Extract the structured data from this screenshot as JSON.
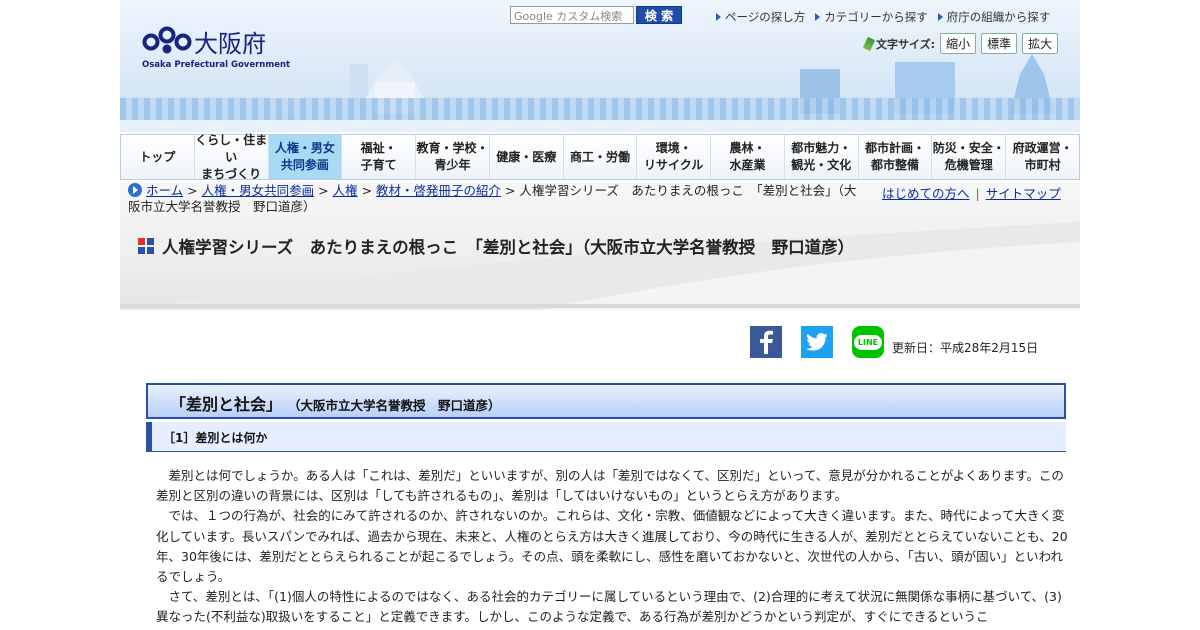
{
  "header": {
    "logo_name": "大阪府",
    "logo_english": "Osaka Prefectural Government",
    "search_placeholder": "Google カスタム検索",
    "search_button": "検 索",
    "top_links": [
      "ページの探し方",
      "カテゴリーから探す",
      "府庁の組織から探す"
    ],
    "font_size_label": "文字サイズ:",
    "font_size_buttons": [
      "縮小",
      "標準",
      "拡大"
    ]
  },
  "nav": {
    "items": [
      "トップ",
      "くらし・住まい\nまちづくり",
      "人権・男女\n共同参画",
      "福祉・\n子育て",
      "教育・学校・\n青少年",
      "健康・医療",
      "商工・労働",
      "環境・\nリサイクル",
      "農林・\n水産業",
      "都市魅力・\n観光・文化",
      "都市計画・\n都市整備",
      "防災・安全・\n危機管理",
      "府政運営・\n市町村"
    ],
    "active_index": 2
  },
  "breadcrumb": {
    "links": [
      "ホーム",
      "人権・男女共同参画",
      "人権",
      "教材・啓発冊子の紹介"
    ],
    "current": "人権学習シリーズ　あたりまえの根っこ　「差別と社会」（大阪市立大学名誉教授　野口道彦）",
    "separator": ">"
  },
  "utility_links": [
    "はじめての方へ",
    "サイトマップ"
  ],
  "page_title": "人権学習シリーズ　あたりまえの根っこ　「差別と社会」（大阪市立大学名誉教授　野口道彦）",
  "share": {
    "icons": [
      "facebook-icon",
      "twitter-icon",
      "line-icon"
    ],
    "line_label": "LINE",
    "updated": "更新日：平成28年2月15日"
  },
  "content": {
    "heading_main": "「差別と社会」",
    "heading_sub": "（大阪市立大学名誉教授　野口道彦）",
    "section_heading": "［1］差別とは何か",
    "paragraphs": [
      "差別とは何でしょうか。ある人は「これは、差別だ」といいますが、別の人は「差別ではなくて、区別だ」といって、意見が分かれることがよくあります。この差別と区別の違いの背景には、区別は「しても許されるもの」、差別は「してはいけないもの」というとらえ方があります。",
      "では、１つの行為が、社会的にみて許されるのか、許されないのか。これらは、文化・宗教、価値観などによって大きく違います。また、時代によって大きく変化しています。長いスパンでみれば、過去から現在、未来と、人権のとらえ方は大きく進展しており、今の時代に生きる人が、差別だととらえていないことも、20年、30年後には、差別だととらえられることが起こるでしょう。その点、頭を柔軟にし、感性を磨いておかないと、次世代の人から、「古い、頭が固い」といわれるでしょう。",
      "さて、差別とは、「(1)個人の特性によるのではなく、ある社会的カテゴリーに属しているという理由で、(2)合理的に考えて状況に無関係な事柄に基づいて、(3)異なった(不利益な)取扱いをすること」と定義できます。しかし、このような定義で、ある行為が差別かどうかという判定が、すぐにできるというこ"
    ]
  },
  "colors": {
    "brand_navy": "#1a237e",
    "nav_active": "#a9d9f3",
    "heading_border": "#2a4fa6",
    "link": "#0a2e9c"
  }
}
